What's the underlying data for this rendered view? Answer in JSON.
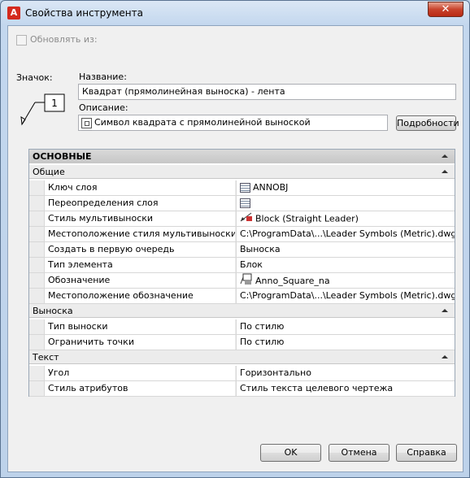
{
  "window": {
    "title": "Свойства инструмента",
    "close_glyph": "✕"
  },
  "update_from": {
    "label": "Обновлять из:",
    "checked": false,
    "enabled": false
  },
  "icon_section": {
    "label": "Значок:",
    "preview_number": "1"
  },
  "name_field": {
    "label": "Название:",
    "value": "Квадрат (прямолинейная выноска) - лента"
  },
  "description_field": {
    "label": "Описание:",
    "value": "Символ квадрата  с прямолинейной выноской"
  },
  "details_button": {
    "label": "Подробности"
  },
  "properties": {
    "main_category": "ОСНОВНЫЕ",
    "groups": [
      {
        "title": "Общие",
        "rows": [
          {
            "name": "Ключ слоя",
            "value": "ANNOBJ",
            "icon": "table-icon"
          },
          {
            "name": "Переопределения слоя",
            "value": "",
            "icon": "table-icon"
          },
          {
            "name": "Стиль мультивыноски",
            "value": "Block (Straight Leader)",
            "icon": "leader-icon"
          },
          {
            "name": "Местоположение стиля мультивыноски",
            "value": "C:\\ProgramData\\...\\Leader Symbols (Metric).dwg",
            "icon": ""
          },
          {
            "name": "Создать в первую очередь",
            "value": "Выноска",
            "icon": ""
          },
          {
            "name": "Тип элемента",
            "value": "Блок",
            "icon": ""
          },
          {
            "name": "Обозначение",
            "value": "Anno_Square_na",
            "icon": "symbol-icon"
          },
          {
            "name": "Местоположение обозначение",
            "value": "C:\\ProgramData\\...\\Leader Symbols (Metric).dwg",
            "icon": ""
          }
        ]
      },
      {
        "title": "Выноска",
        "rows": [
          {
            "name": "Тип выноски",
            "value": "По стилю",
            "icon": ""
          },
          {
            "name": "Ограничить точки",
            "value": "По стилю",
            "icon": ""
          }
        ]
      },
      {
        "title": "Текст",
        "rows": [
          {
            "name": "Угол",
            "value": "Горизонтально",
            "icon": ""
          },
          {
            "name": "Стиль атрибутов",
            "value": "Стиль текста целевого чертежа",
            "icon": ""
          }
        ]
      }
    ]
  },
  "buttons": {
    "ok": "OK",
    "cancel": "Отмена",
    "help": "Справка"
  }
}
